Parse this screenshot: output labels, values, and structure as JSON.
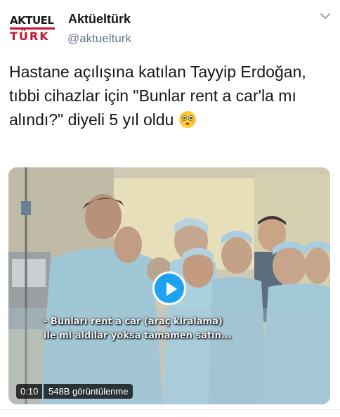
{
  "account": {
    "logo_top": "AKTUEL",
    "logo_bottom": "TÜRK",
    "display_name": "Aktüeltürk",
    "handle": "@aktuelturk"
  },
  "tweet": {
    "text": "Hastane açılışına katılan Tayyip Erdoğan, tıbbi cihazlar için \"Bunlar rent a car'la mı alındı?\" diyeli 5 yıl oldu",
    "emoji": "flushed-face-emoji"
  },
  "media": {
    "subtitle_line1": "- Bunları rent a car (araç kiralama)",
    "subtitle_line2": "ile mi aldılar yoksa tamamen satın...",
    "duration": "0:10",
    "views": "548B görüntülenme",
    "play_icon": "play-icon"
  },
  "colors": {
    "accent": "#1da1f2",
    "logo_red": "#c8102e",
    "handle_gray": "#657786"
  }
}
